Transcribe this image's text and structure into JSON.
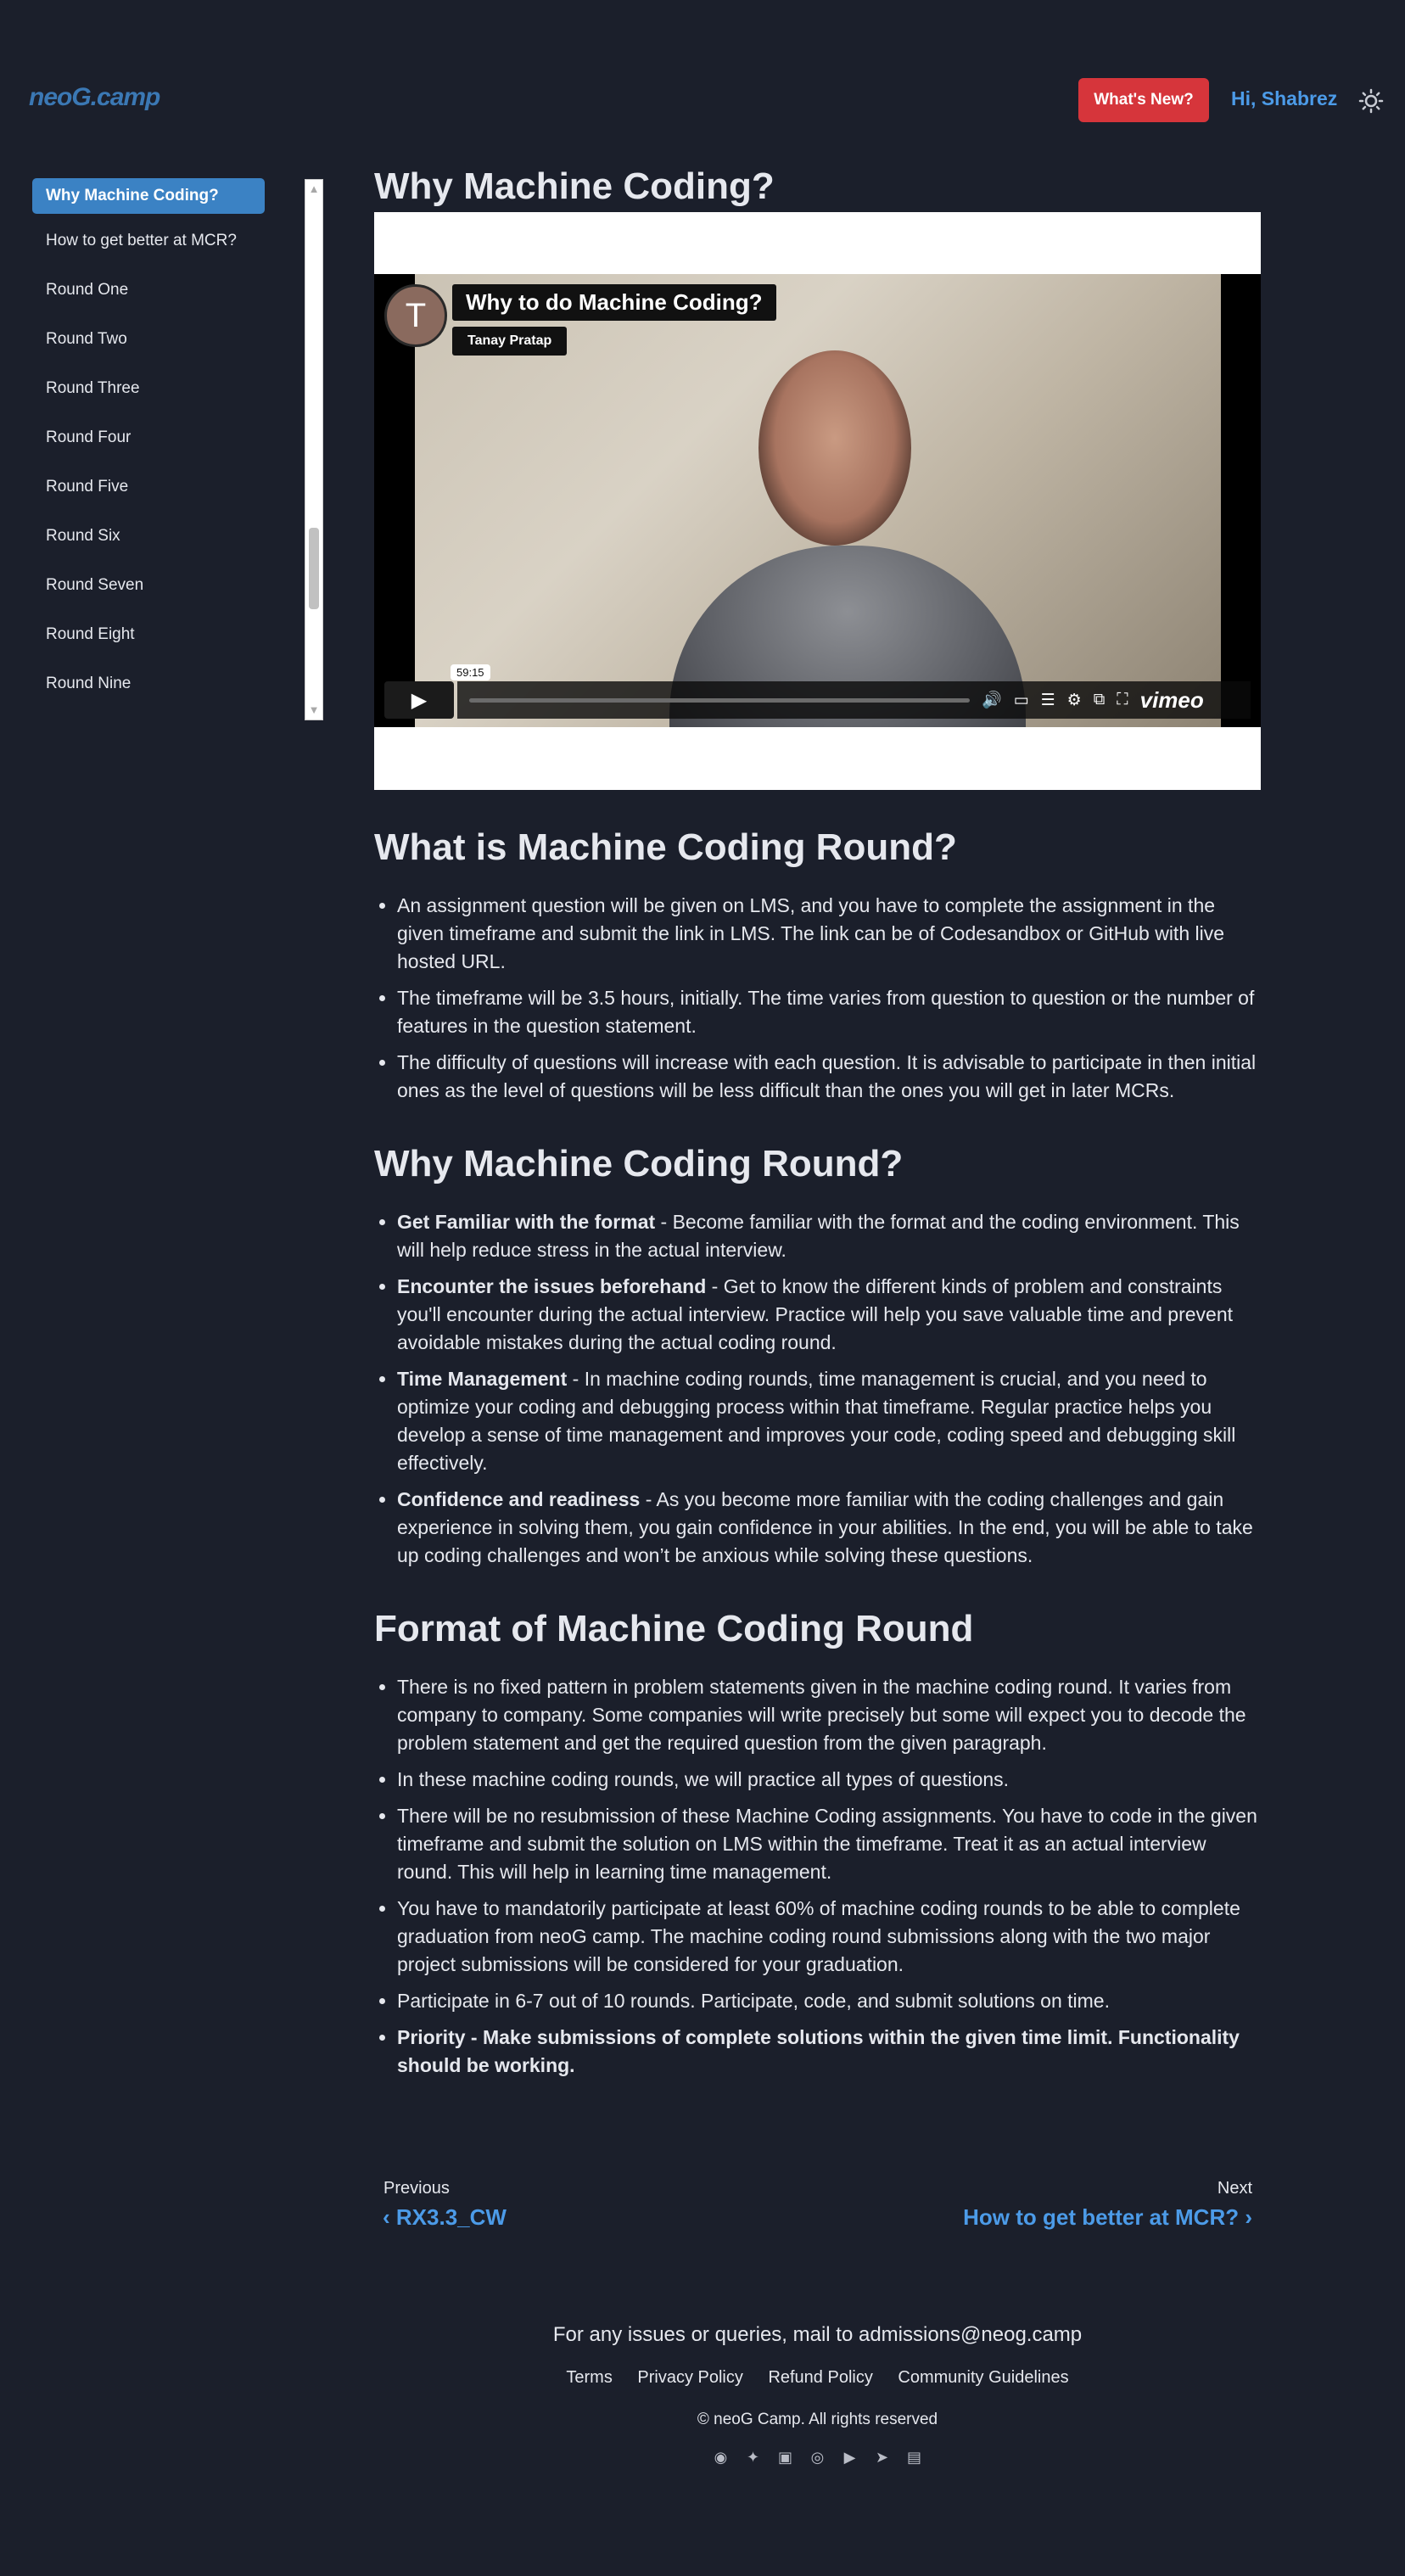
{
  "header": {
    "logo": "neoG.camp",
    "whats_new": "What's New?",
    "greeting": "Hi, Shabrez",
    "theme_icon": "sun-icon"
  },
  "sidebar": {
    "items": [
      {
        "label": "Why Machine Coding?"
      },
      {
        "label": "How to get better at MCR?"
      },
      {
        "label": "Round One"
      },
      {
        "label": "Round Two"
      },
      {
        "label": "Round Three"
      },
      {
        "label": "Round Four"
      },
      {
        "label": "Round Five"
      },
      {
        "label": "Round Six"
      },
      {
        "label": "Round Seven"
      },
      {
        "label": "Round Eight"
      },
      {
        "label": "Round Nine"
      }
    ]
  },
  "video": {
    "avatar_letter": "T",
    "title": "Why to do Machine Coding?",
    "author": "Tanay Pratap",
    "time": "59:15",
    "brand": "vimeo"
  },
  "page_title": "Why Machine Coding?",
  "sections": [
    {
      "heading": "What is Machine Coding Round?",
      "items": [
        {
          "bold": "",
          "text": "An assignment question will be given on LMS, and you have to complete the assignment in the given timeframe and submit the link in LMS. The link can be of Codesandbox or GitHub with live hosted URL."
        },
        {
          "bold": "",
          "text": "The timeframe will be 3.5 hours, initially. The time varies from question to question or the number of features in the question statement."
        },
        {
          "bold": "",
          "text": "The difficulty of questions will increase with each question. It is advisable to participate in then initial ones as the level of questions will be less difficult than the ones you will get in later MCRs."
        }
      ]
    },
    {
      "heading": "Why Machine Coding Round?",
      "items": [
        {
          "bold": "Get Familiar with the format",
          "text": " - Become familiar with the format and the coding environment. This will help reduce stress in the actual interview."
        },
        {
          "bold": "Encounter the issues beforehand",
          "text": " - Get to know the different kinds of problem and constraints you'll encounter during the actual interview. Practice will help you save valuable time and prevent avoidable mistakes during the actual coding round."
        },
        {
          "bold": "Time Management",
          "text": " - In machine coding rounds, time management is crucial, and you need to optimize your coding and debugging process within that timeframe. Regular practice helps you develop a sense of time management and improves your code, coding speed and debugging skill effectively."
        },
        {
          "bold": "Confidence and readiness",
          "text": " - As you become more familiar with the coding challenges and gain experience in solving them, you gain confidence in your abilities. In the end, you will be able to take up coding challenges and won’t be anxious while solving these questions."
        }
      ]
    },
    {
      "heading": "Format of Machine Coding Round",
      "items": [
        {
          "bold": "",
          "text": "There is no fixed pattern in problem statements given in the machine coding round. It varies from company to company. Some companies will write precisely but some will expect you to decode the problem statement and get the required question from the given paragraph."
        },
        {
          "bold": "",
          "text": "In these machine coding rounds, we will practice all types of questions."
        },
        {
          "bold": "",
          "text": "There will be no resubmission of these Machine Coding assignments. You have to code in the given timeframe and submit the solution on LMS within the timeframe. Treat it as an actual interview round. This will help in learning time management."
        },
        {
          "bold": "",
          "text": "You have to mandatorily participate at least 60% of machine coding rounds to be able to complete graduation from neoG camp. The machine coding round submissions along with the two major project submissions will be considered for your graduation."
        },
        {
          "bold": "",
          "text": "Participate in 6-7 out of 10 rounds. Participate, code, and submit solutions on time."
        },
        {
          "bold": "Priority - Make submissions of complete solutions within the given time limit. Functionality should be working.",
          "text": ""
        }
      ]
    }
  ],
  "nav": {
    "prev_label": "Previous",
    "prev_title": "RX3.3_CW",
    "next_label": "Next",
    "next_title": "How to get better at MCR?"
  },
  "footer": {
    "mail": "For any issues or queries, mail to admissions@neog.camp",
    "links": [
      "Terms",
      "Privacy Policy",
      "Refund Policy",
      "Community Guidelines"
    ],
    "copyright": "© neoG Camp. All rights reserved",
    "socials": [
      "github-icon",
      "twitter-icon",
      "linkedin-icon",
      "instagram-icon",
      "youtube-icon",
      "telegram-icon",
      "bookshelf-icon"
    ]
  }
}
